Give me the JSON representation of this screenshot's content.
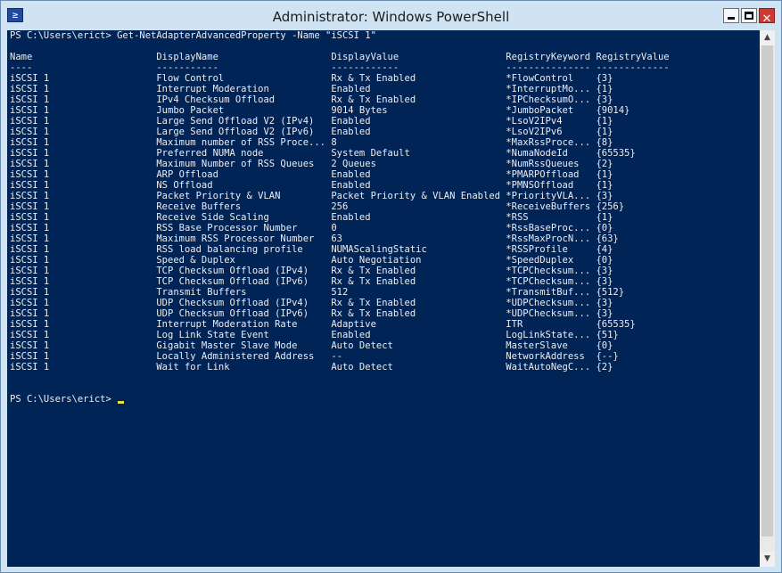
{
  "window": {
    "title": "Administrator: Windows PowerShell",
    "icon": "powershell-icon",
    "icon_glyph": "≥",
    "close_glyph": "✕"
  },
  "console": {
    "prompt_command": "PS C:\\Users\\erict> Get-NetAdapterAdvancedProperty -Name \"iSCSI 1\"",
    "columns": [
      "Name",
      "DisplayName",
      "DisplayValue",
      "RegistryKeyword",
      "RegistryValue"
    ],
    "underlines": [
      "----",
      "-----------",
      "------------",
      "---------------",
      "-------------"
    ],
    "rows": [
      [
        "iSCSI 1",
        "Flow Control",
        "Rx & Tx Enabled",
        "*FlowControl",
        "{3}"
      ],
      [
        "iSCSI 1",
        "Interrupt Moderation",
        "Enabled",
        "*InterruptMo...",
        "{1}"
      ],
      [
        "iSCSI 1",
        "IPv4 Checksum Offload",
        "Rx & Tx Enabled",
        "*IPChecksumO...",
        "{3}"
      ],
      [
        "iSCSI 1",
        "Jumbo Packet",
        "9014 Bytes",
        "*JumboPacket",
        "{9014}"
      ],
      [
        "iSCSI 1",
        "Large Send Offload V2 (IPv4)",
        "Enabled",
        "*LsoV2IPv4",
        "{1}"
      ],
      [
        "iSCSI 1",
        "Large Send Offload V2 (IPv6)",
        "Enabled",
        "*LsoV2IPv6",
        "{1}"
      ],
      [
        "iSCSI 1",
        "Maximum number of RSS Proce...",
        "8",
        "*MaxRssProce...",
        "{8}"
      ],
      [
        "iSCSI 1",
        "Preferred NUMA node",
        "System Default",
        "*NumaNodeId",
        "{65535}"
      ],
      [
        "iSCSI 1",
        "Maximum Number of RSS Queues",
        "2 Queues",
        "*NumRssQueues",
        "{2}"
      ],
      [
        "iSCSI 1",
        "ARP Offload",
        "Enabled",
        "*PMARPOffload",
        "{1}"
      ],
      [
        "iSCSI 1",
        "NS Offload",
        "Enabled",
        "*PMNSOffload",
        "{1}"
      ],
      [
        "iSCSI 1",
        "Packet Priority & VLAN",
        "Packet Priority & VLAN Enabled",
        "*PriorityVLA...",
        "{3}"
      ],
      [
        "iSCSI 1",
        "Receive Buffers",
        "256",
        "*ReceiveBuffers",
        "{256}"
      ],
      [
        "iSCSI 1",
        "Receive Side Scaling",
        "Enabled",
        "*RSS",
        "{1}"
      ],
      [
        "iSCSI 1",
        "RSS Base Processor Number",
        "0",
        "*RssBaseProc...",
        "{0}"
      ],
      [
        "iSCSI 1",
        "Maximum RSS Processor Number",
        "63",
        "*RssMaxProcN...",
        "{63}"
      ],
      [
        "iSCSI 1",
        "RSS load balancing profile",
        "NUMAScalingStatic",
        "*RSSProfile",
        "{4}"
      ],
      [
        "iSCSI 1",
        "Speed & Duplex",
        "Auto Negotiation",
        "*SpeedDuplex",
        "{0}"
      ],
      [
        "iSCSI 1",
        "TCP Checksum Offload (IPv4)",
        "Rx & Tx Enabled",
        "*TCPChecksum...",
        "{3}"
      ],
      [
        "iSCSI 1",
        "TCP Checksum Offload (IPv6)",
        "Rx & Tx Enabled",
        "*TCPChecksum...",
        "{3}"
      ],
      [
        "iSCSI 1",
        "Transmit Buffers",
        "512",
        "*TransmitBuf...",
        "{512}"
      ],
      [
        "iSCSI 1",
        "UDP Checksum Offload (IPv4)",
        "Rx & Tx Enabled",
        "*UDPChecksum...",
        "{3}"
      ],
      [
        "iSCSI 1",
        "UDP Checksum Offload (IPv6)",
        "Rx & Tx Enabled",
        "*UDPChecksum...",
        "{3}"
      ],
      [
        "iSCSI 1",
        "Interrupt Moderation Rate",
        "Adaptive",
        "ITR",
        "{65535}"
      ],
      [
        "iSCSI 1",
        "Log Link State Event",
        "Enabled",
        "LogLinkState...",
        "{51}"
      ],
      [
        "iSCSI 1",
        "Gigabit Master Slave Mode",
        "Auto Detect",
        "MasterSlave",
        "{0}"
      ],
      [
        "iSCSI 1",
        "Locally Administered Address",
        "--",
        "NetworkAddress",
        "{--}"
      ],
      [
        "iSCSI 1",
        "Wait for Link",
        "Auto Detect",
        "WaitAutoNegC...",
        "{2}"
      ]
    ],
    "final_prompt": "PS C:\\Users\\erict> "
  },
  "colors": {
    "console_background": "#012456",
    "console_text": "#eeedf0",
    "cursor": "#e6e34a",
    "close_button": "#cc3b31"
  }
}
